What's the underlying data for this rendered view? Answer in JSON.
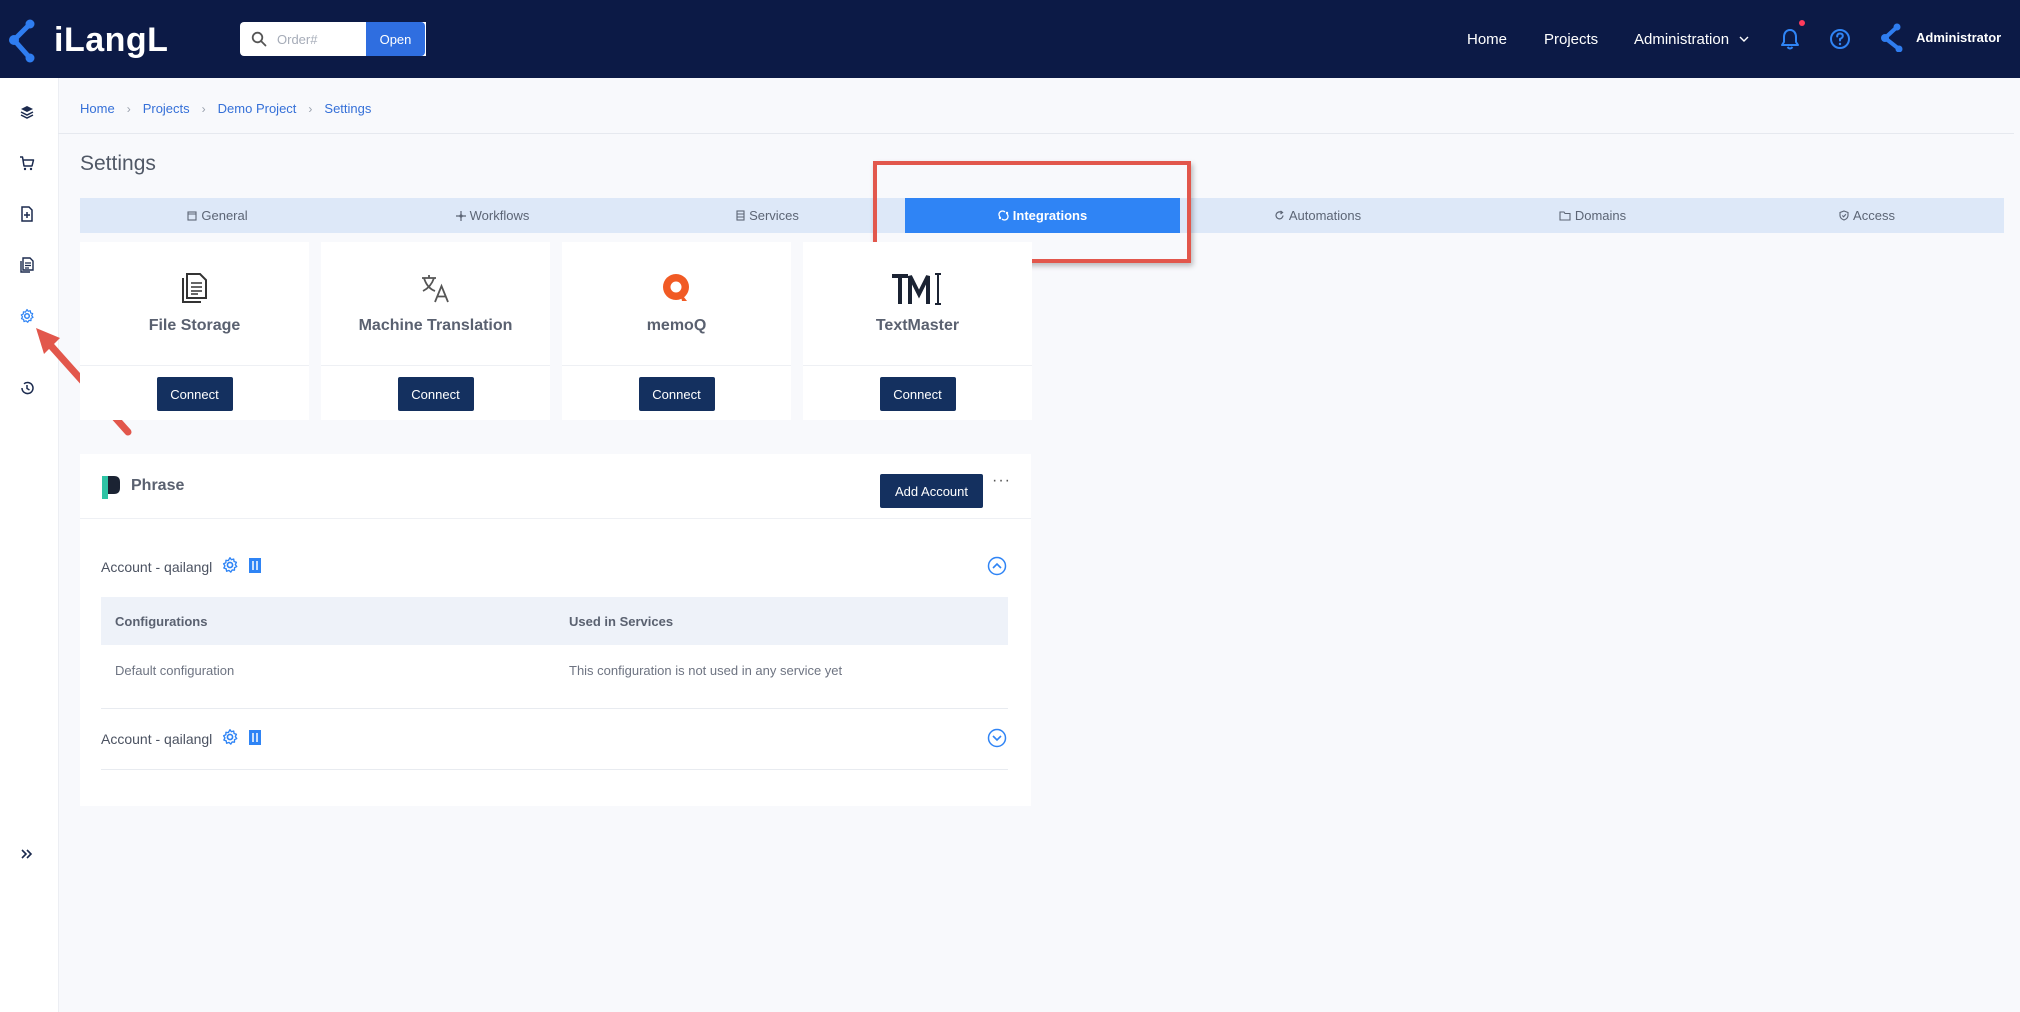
{
  "app": {
    "logo_text": "iLangL"
  },
  "topbar": {
    "search_placeholder": "Order#",
    "open_label": "Open",
    "nav": {
      "home": "Home",
      "projects": "Projects",
      "administration": "Administration"
    },
    "user_name": "Administrator",
    "notification_dot_color": "#ff3b5c"
  },
  "sidebar": {
    "icons": [
      "layers-icon",
      "cart-icon",
      "document-add-icon",
      "documents-icon",
      "settings-icon",
      "history-icon",
      "expand-icon"
    ],
    "active": "settings-icon"
  },
  "breadcrumb": [
    "Home",
    "Projects",
    "Demo Project",
    "Settings"
  ],
  "page_title": "Settings",
  "tabs": [
    {
      "label": "General",
      "icon": "window-icon"
    },
    {
      "label": "Workflows",
      "icon": "workflow-icon"
    },
    {
      "label": "Services",
      "icon": "server-icon"
    },
    {
      "label": "Integrations",
      "icon": "integration-icon",
      "active": true
    },
    {
      "label": "Automations",
      "icon": "refresh-icon"
    },
    {
      "label": "Domains",
      "icon": "folder-icon"
    },
    {
      "label": "Access",
      "icon": "shield-icon"
    }
  ],
  "integrations": [
    {
      "name": "File Storage",
      "button": "Connect",
      "icon": "file-storage-icon"
    },
    {
      "name": "Machine Translation",
      "button": "Connect",
      "icon": "translate-icon"
    },
    {
      "name": "memoQ",
      "button": "Connect",
      "icon": "memoq-logo-icon"
    },
    {
      "name": "TextMaster",
      "button": "Connect",
      "icon": "textmaster-logo-icon"
    }
  ],
  "phrase": {
    "title": "Phrase",
    "add_account_label": "Add Account",
    "more_label": "···",
    "accounts": [
      {
        "label": "Account - qailangl",
        "expanded": true
      },
      {
        "label": "Account - qailangl",
        "expanded": false
      }
    ],
    "table": {
      "headers": [
        "Configurations",
        "Used in Services"
      ],
      "rows": [
        [
          "Default configuration",
          "This configuration is not used in any service yet"
        ]
      ]
    }
  },
  "colors": {
    "topbar": "#0c1a46",
    "accent": "#2f84f5",
    "button_dark": "#14305f",
    "annotation": "#e2574c"
  }
}
